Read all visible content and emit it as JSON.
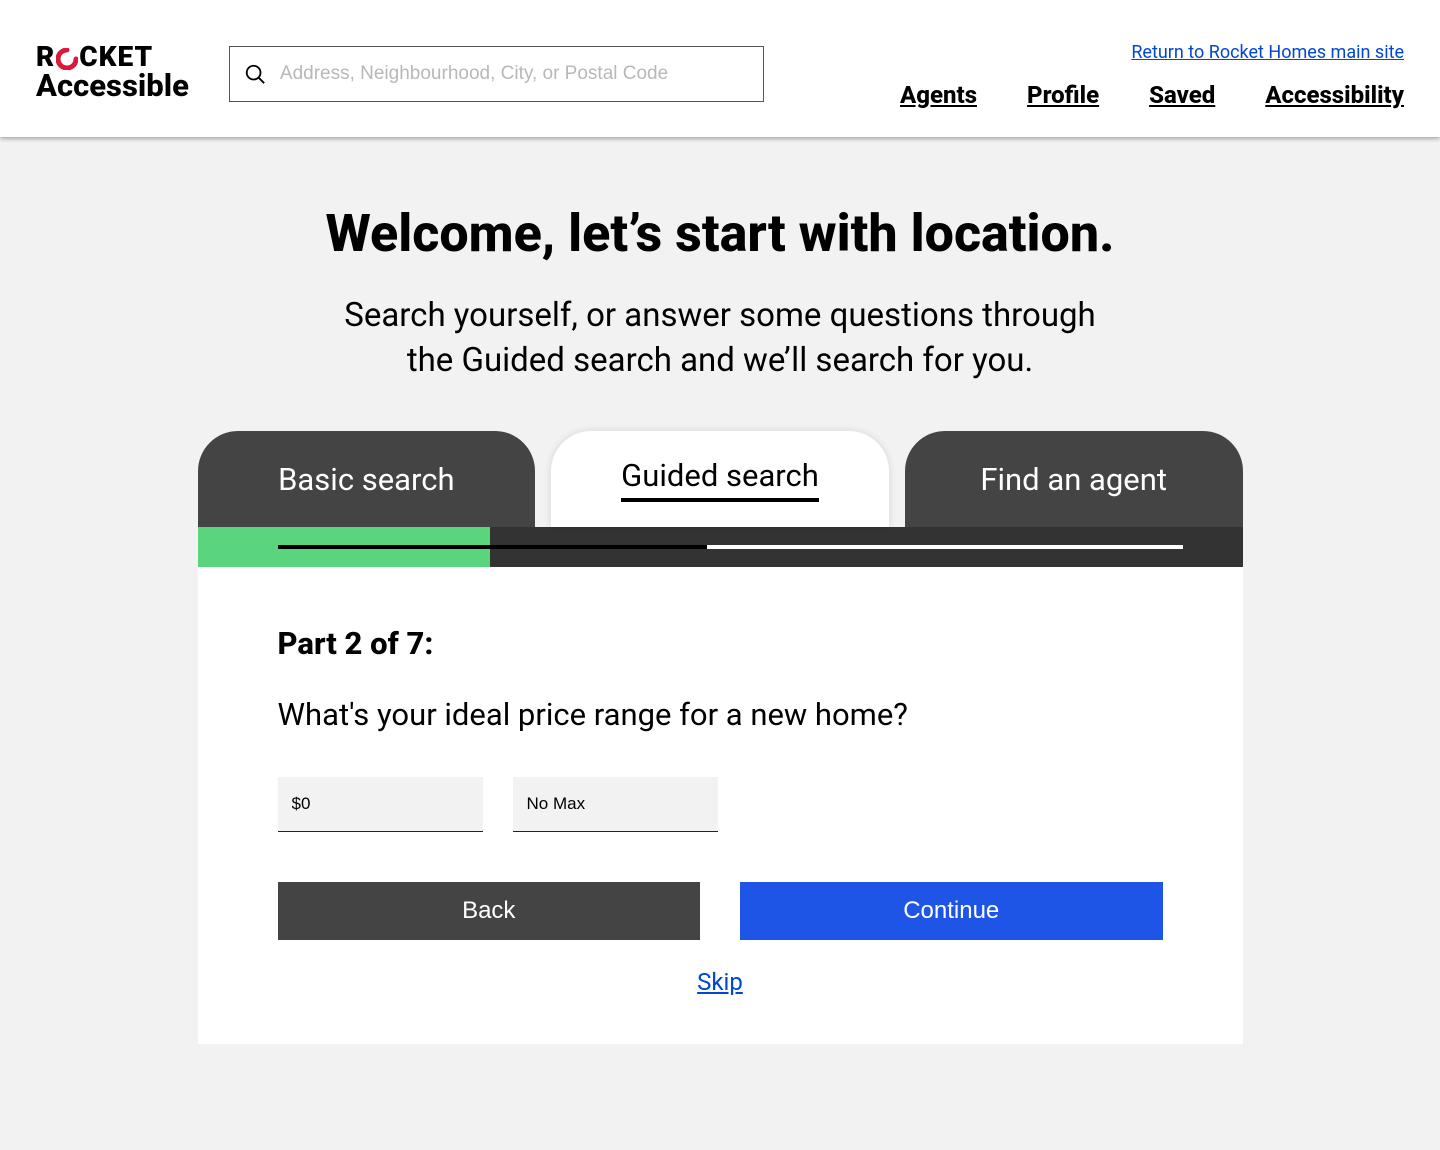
{
  "header": {
    "logo_top_left": "R",
    "logo_top_right": "CKET",
    "logo_bottom": "Accessible",
    "search_placeholder": "Address, Neighbourhood, City, or Postal Code",
    "return_link": "Return to Rocket Homes main site",
    "nav": {
      "agents": "Agents",
      "profile": "Profile",
      "saved": "Saved",
      "accessibility": "Accessibility"
    }
  },
  "main": {
    "title": "Welcome, let’s start with location.",
    "subtitle_line1": "Search yourself, or answer some questions through",
    "subtitle_line2": "the Guided search and we’ll search for you.",
    "tabs": {
      "basic": "Basic search",
      "guided": "Guided search",
      "agent": "Find an agent"
    },
    "panel": {
      "part_label": "Part 2 of 7:",
      "question": "What's your ideal price range for a new home?",
      "min_value": "$0",
      "max_value": "No Max",
      "back": "Back",
      "continue": "Continue",
      "skip": "Skip"
    },
    "progress_percent": 28
  },
  "colors": {
    "accent_red": "#d81b3b",
    "link_blue": "#0047d1",
    "button_blue": "#1e55e6",
    "progress_green": "#5bd47e",
    "tab_dark": "#444444"
  }
}
